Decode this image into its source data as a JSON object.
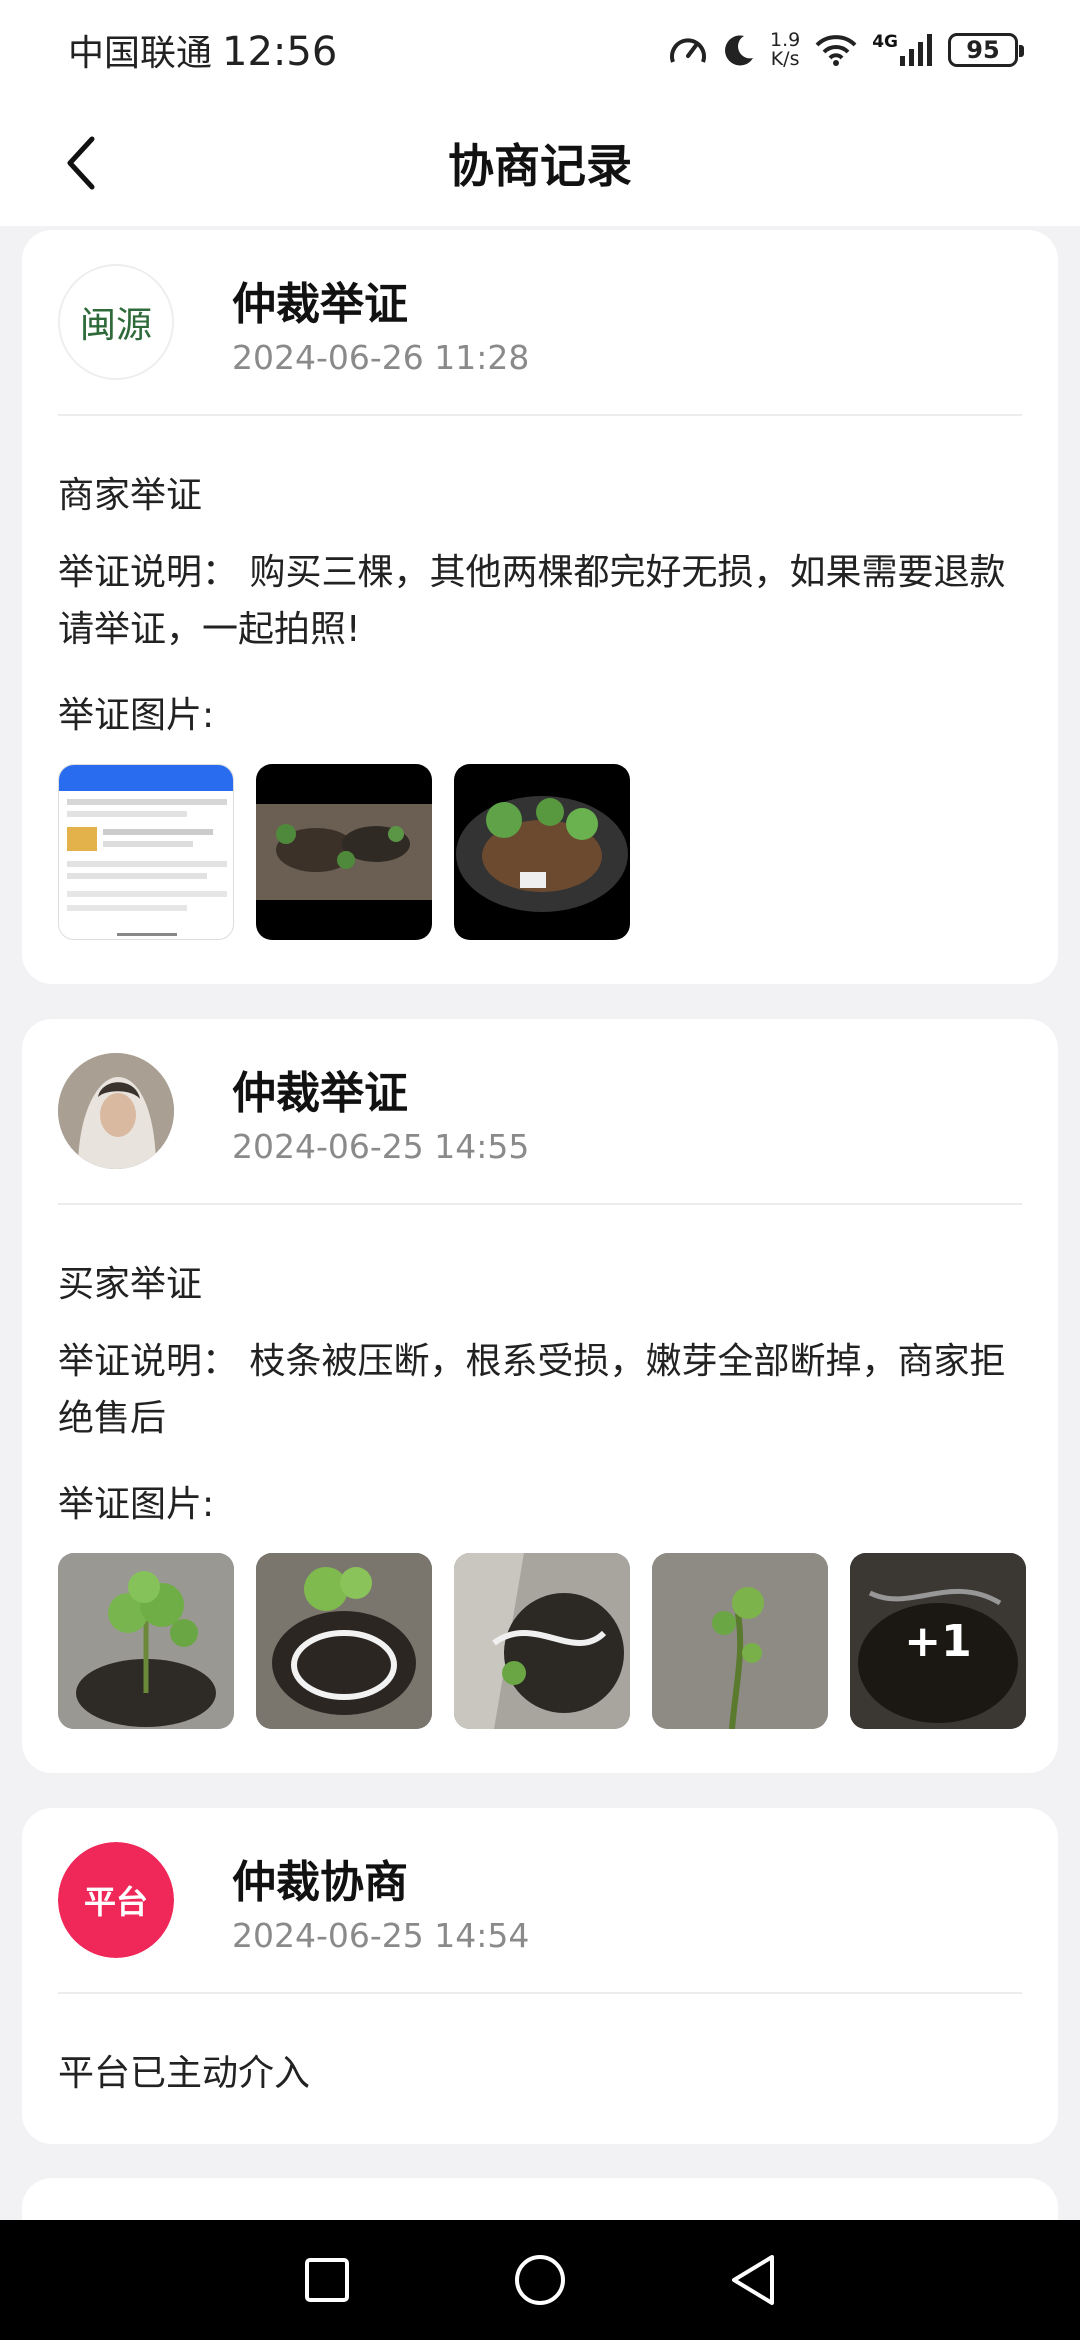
{
  "status_bar": {
    "carrier": "中国联通",
    "time": "12:56",
    "net_speed_value": "1.9",
    "net_speed_unit": "K/s",
    "network_type": "4G",
    "battery": "95"
  },
  "header": {
    "title": "协商记录"
  },
  "records": [
    {
      "title": "仲裁举证",
      "time": "2024-06-26 11:28",
      "role": "商家举证",
      "description": "举证说明：  购买三棵，其他两棵都完好无损，如果需要退款请举证，一起拍照!",
      "images_label": "举证图片:",
      "avatar_logo_text": "闽源"
    },
    {
      "title": "仲裁举证",
      "time": "2024-06-25 14:55",
      "role": "买家举证",
      "description": "举证说明：  枝条被压断，根系受损，嫩芽全部断掉，商家拒绝售后",
      "images_label": "举证图片:",
      "more_count": "+1"
    },
    {
      "title": "仲裁协商",
      "time": "2024-06-25 14:54",
      "badge": "平台",
      "description": "平台已主动介入"
    }
  ],
  "colors": {
    "platform_badge": "#f0285a",
    "background": "#f2f2f4",
    "time_text": "#8a8a8a"
  }
}
